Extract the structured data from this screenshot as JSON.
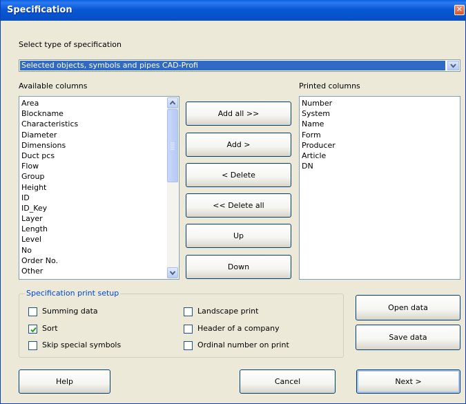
{
  "window": {
    "title": "Specification",
    "close_icon": "close-icon"
  },
  "spec_type": {
    "label": "Select type of specification",
    "selected": "Selected objects, symbols and pipes CAD-Profi"
  },
  "available": {
    "label": "Available columns",
    "items": [
      "Area",
      "Blockname",
      "Characteristics",
      "Diameter",
      "Dimensions",
      "Duct pcs",
      "Flow",
      "Group",
      "Height",
      "ID",
      "ID_Key",
      "Layer",
      "Length",
      "Level",
      "No",
      "Order No.",
      "Other"
    ]
  },
  "printed": {
    "label": "Printed columns",
    "items": [
      "Number",
      "System",
      "Name",
      "Form",
      "Producer",
      "Article",
      "DN"
    ]
  },
  "middle_buttons": {
    "add_all": "Add all >>",
    "add": "Add >",
    "delete": "< Delete",
    "delete_all": "<< Delete all",
    "up": "Up",
    "down": "Down"
  },
  "print_setup": {
    "legend": "Specification print setup",
    "summing_data": {
      "label": "Summing data",
      "checked": false
    },
    "sort": {
      "label": "Sort",
      "checked": true
    },
    "skip_special": {
      "label": "Skip special symbols",
      "checked": false
    },
    "landscape": {
      "label": "Landscape print",
      "checked": false
    },
    "header_company": {
      "label": "Header of a company",
      "checked": false
    },
    "ordinal_number": {
      "label": "Ordinal number on print",
      "checked": false
    }
  },
  "side_buttons": {
    "open_data": "Open data",
    "save_data": "Save data"
  },
  "footer": {
    "help": "Help",
    "cancel": "Cancel",
    "next": "Next >"
  },
  "colors": {
    "title_bar": "#0a58d6",
    "selection": "#316ac5",
    "accent_legend": "#0046d5",
    "dialog_bg": "#ece9d8"
  }
}
